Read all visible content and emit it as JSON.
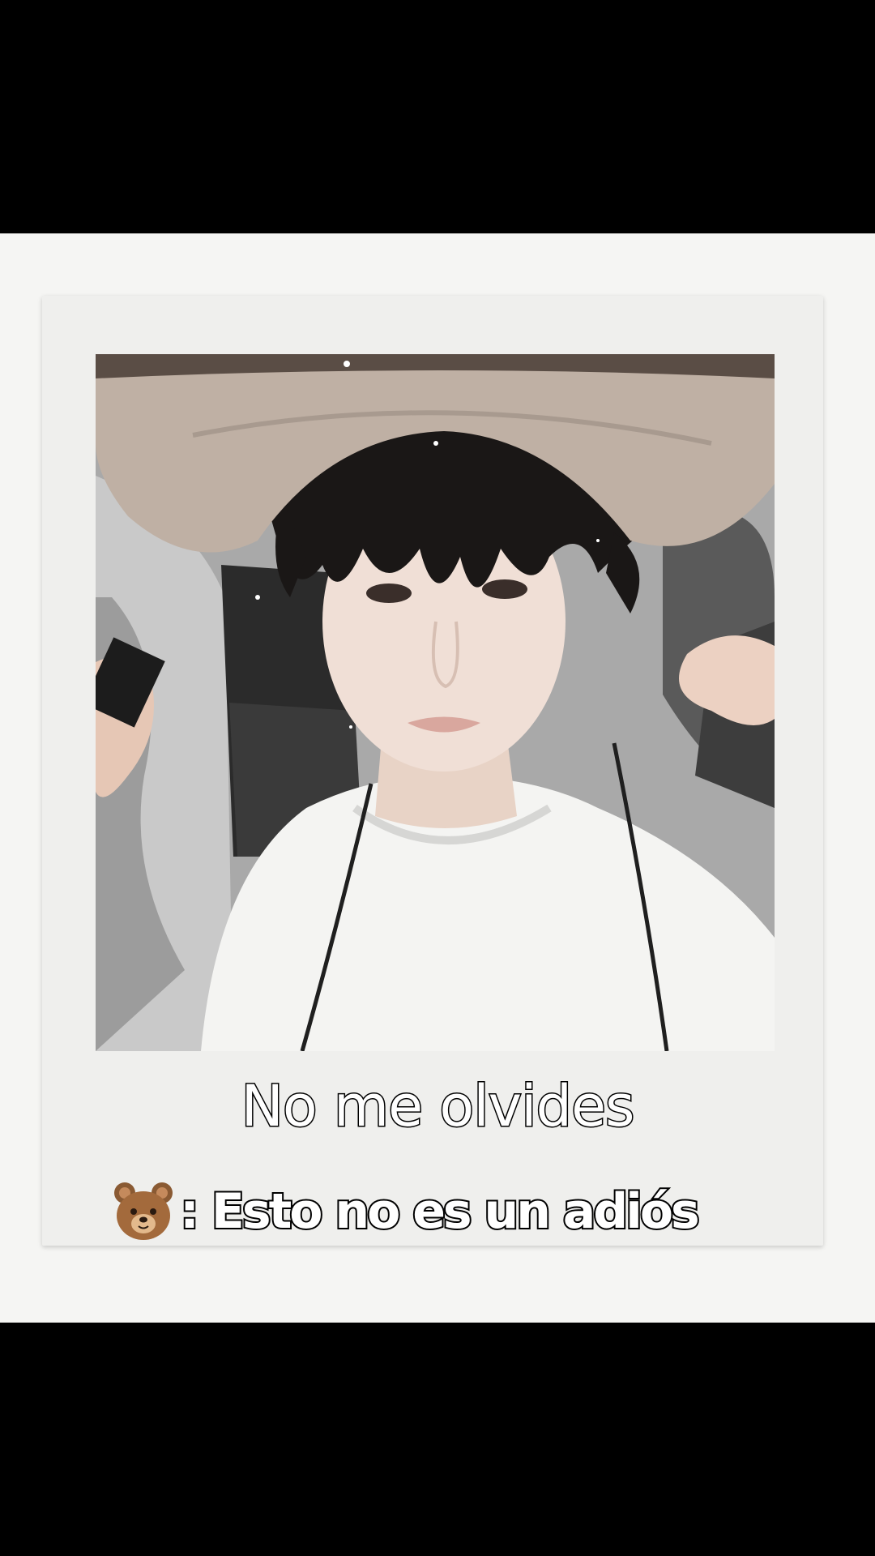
{
  "caption": {
    "title": "No me olvides",
    "subtitle": ": Esto no es un adiós",
    "subtitle_icon": "bear-face-icon"
  },
  "colors": {
    "letterbox": "#000000",
    "frame_background": "#f5f5f3",
    "polaroid": "#efefed",
    "caption_text": "#ffffff",
    "caption_outline": "#000000"
  }
}
